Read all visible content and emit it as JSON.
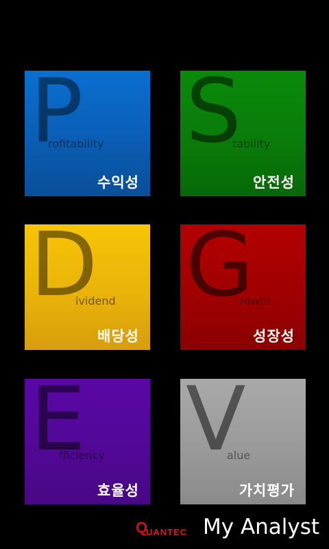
{
  "tiles": [
    {
      "key": "profitability",
      "letter": "P",
      "rest": "rofitability",
      "korean": "수익성",
      "color": "#0a5cb2"
    },
    {
      "key": "stability",
      "letter": "S",
      "rest": "tability",
      "korean": "안전성",
      "color": "#0a7a0a"
    },
    {
      "key": "dividend",
      "letter": "D",
      "rest": "ividend",
      "korean": "배당성",
      "color": "#eab309"
    },
    {
      "key": "growth",
      "letter": "G",
      "rest": "rowth",
      "korean": "성장성",
      "color": "#a00000"
    },
    {
      "key": "efficiency",
      "letter": "E",
      "rest": "fficiency",
      "korean": "효율성",
      "color": "#520896"
    },
    {
      "key": "value",
      "letter": "V",
      "rest": "alue",
      "korean": "가치평가",
      "color": "#9a9a9a"
    }
  ],
  "footer": {
    "logo_q": "Q",
    "logo_rest": "UANTEC",
    "app_title": "My Analyst",
    "logo_color": "#d01010"
  }
}
